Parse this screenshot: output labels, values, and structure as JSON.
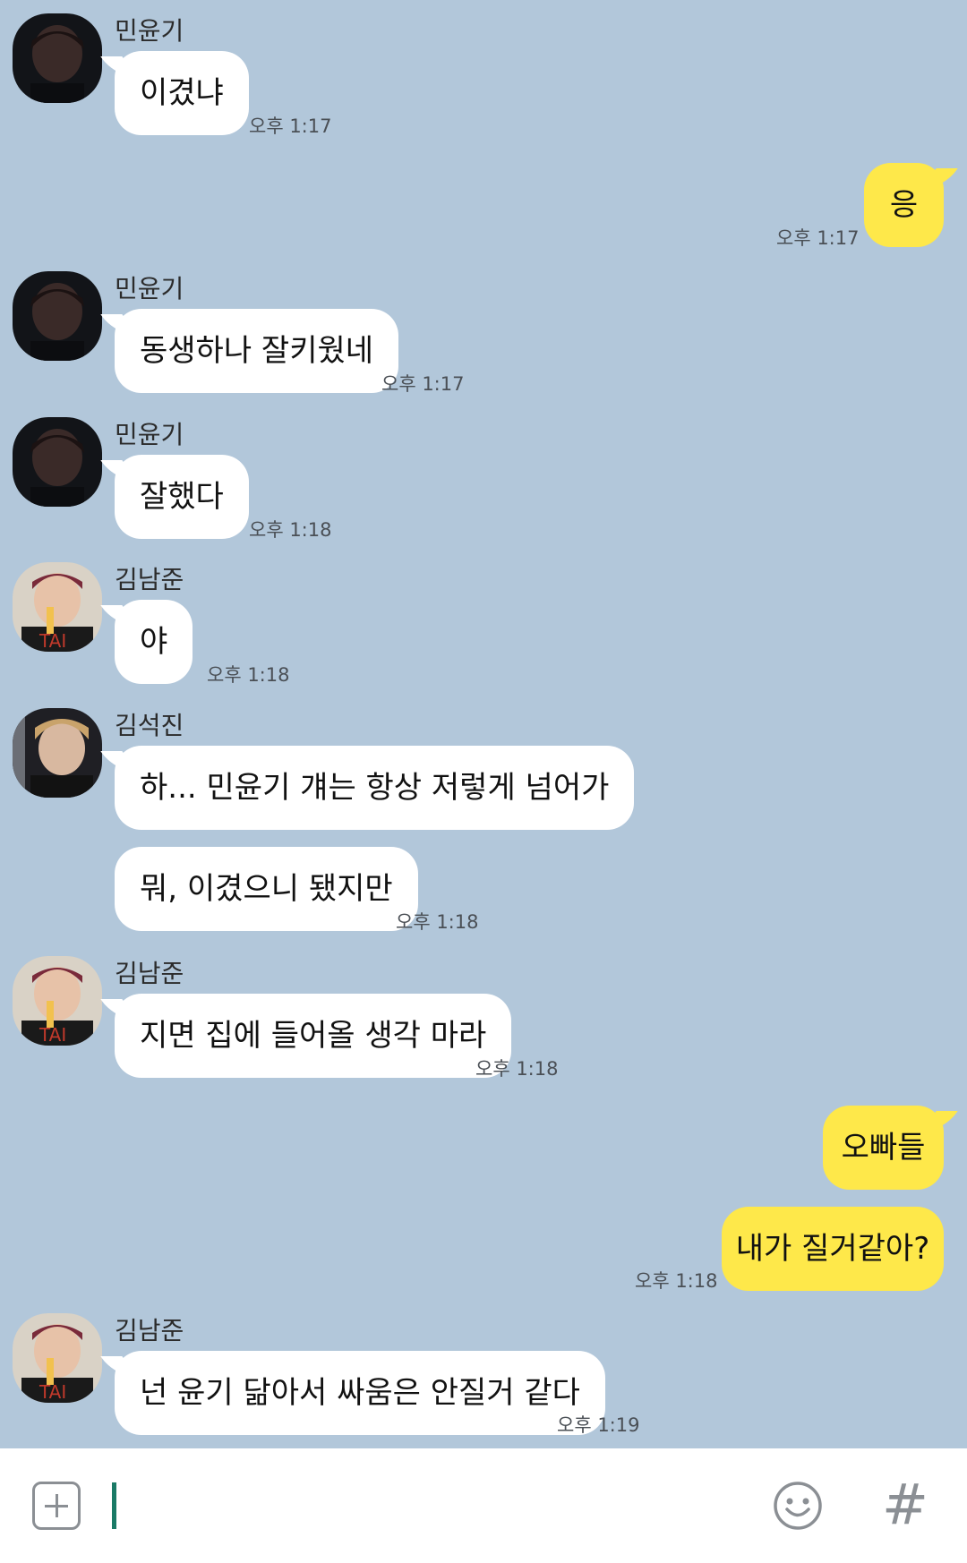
{
  "messages": {
    "m1": {
      "sender": "민윤기",
      "text": "이겼냐",
      "time": "오후 1:17"
    },
    "m2": {
      "text": "응",
      "time": "오후 1:17"
    },
    "m3": {
      "sender": "민윤기",
      "text": "동생하나 잘키웠네",
      "time": "오후 1:17"
    },
    "m4": {
      "sender": "민윤기",
      "text": "잘했다",
      "time": "오후 1:18"
    },
    "m5": {
      "sender": "김남준",
      "text": "야",
      "time": "오후 1:18"
    },
    "m6": {
      "sender": "김석진",
      "text1": "하... 민윤기 걔는 항상 저렇게 넘어가",
      "text2": "뭐, 이겼으니 됐지만",
      "time": "오후 1:18"
    },
    "m7": {
      "sender": "김남준",
      "text": "지면 집에 들어올 생각 마라",
      "time": "오후 1:18"
    },
    "m8": {
      "text1": "오빠들",
      "text2": "내가 질거같아?",
      "time": "오후 1:18"
    },
    "m9": {
      "sender": "김남준",
      "text": "넌 윤기 닮아서 싸움은 안질거 같다",
      "time": "오후 1:19"
    }
  },
  "input": {
    "value": ""
  },
  "icons": {
    "attach": "plus-square-icon",
    "emoji": "smiley-icon",
    "hashtag": "hashtag-icon"
  },
  "colors": {
    "background": "#b2c7da",
    "my_bubble": "#fee84a",
    "other_bubble": "#ffffff"
  }
}
